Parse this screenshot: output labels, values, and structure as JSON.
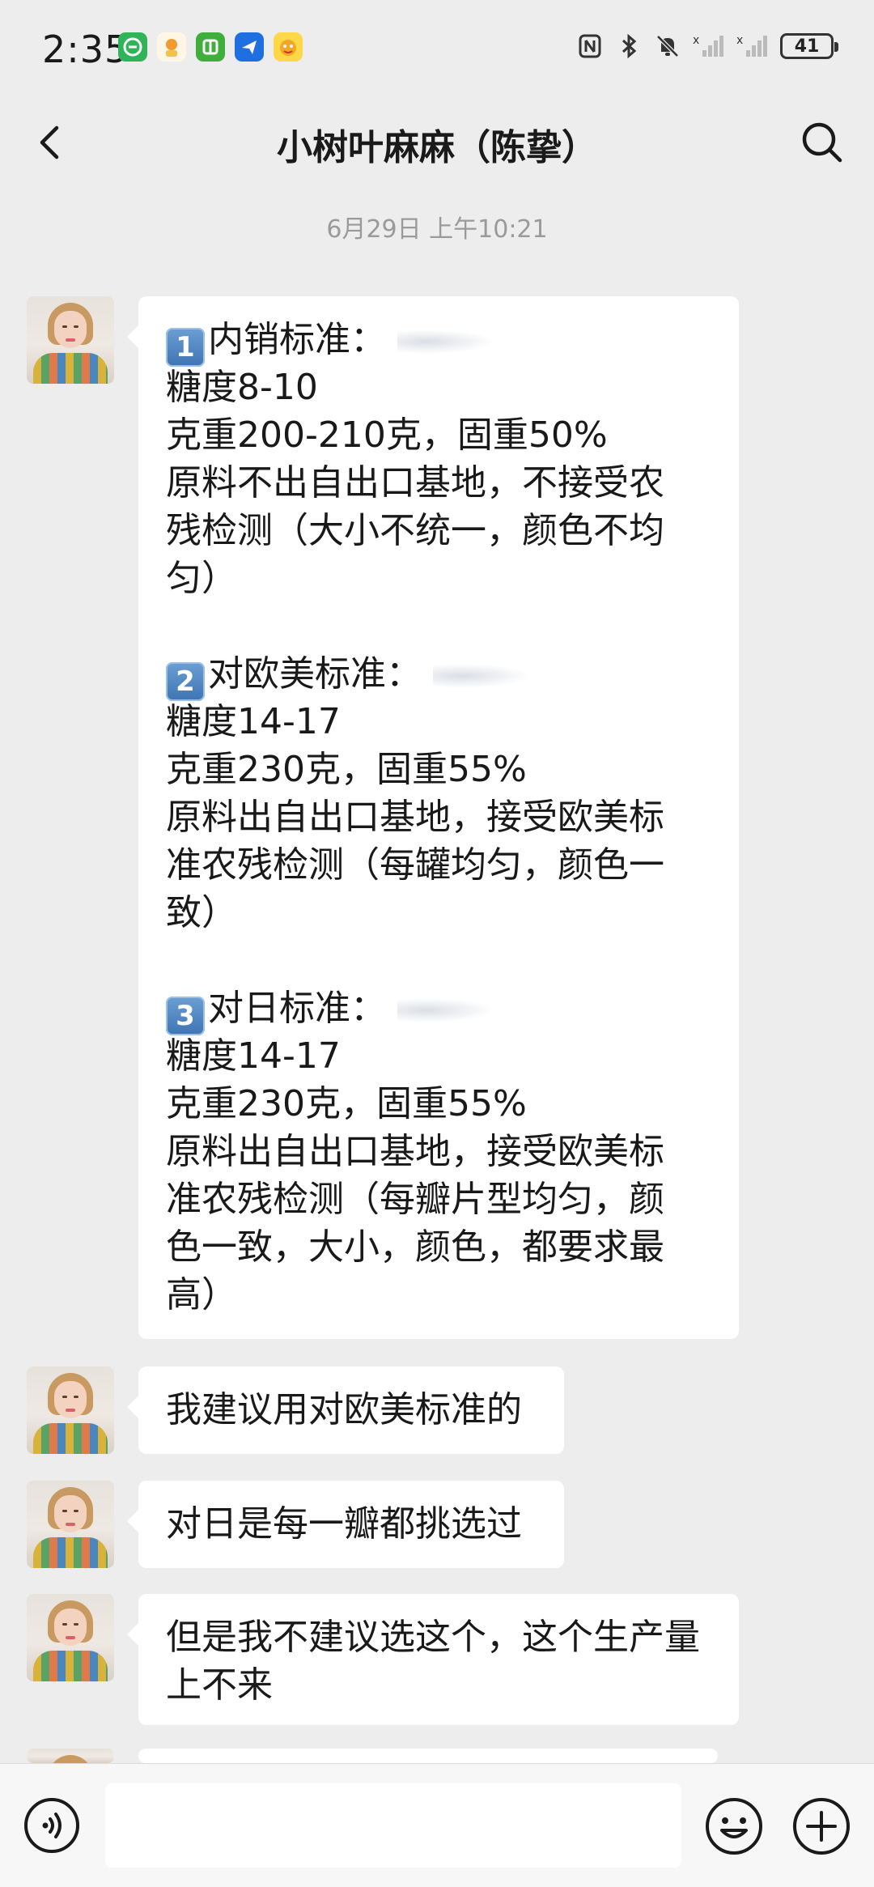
{
  "status_bar": {
    "time": "2:35",
    "battery": "41",
    "app_icons": [
      "green-leaf-app-icon",
      "orange-mascot-app-icon",
      "green-app-icon",
      "blue-plane-app-icon",
      "yellow-cartoon-app-icon"
    ],
    "system_icons": [
      "nfc-icon",
      "bluetooth-icon",
      "mute-bell-icon",
      "signal-x-icon",
      "signal-x-icon",
      "battery-icon"
    ]
  },
  "header": {
    "title": "小树叶麻麻（陈挚）"
  },
  "timestamp": "6月29日 上午10:21",
  "messages": [
    {
      "lines": [
        {
          "badge": "1",
          "text": "内销标准："
        },
        {
          "text": "糖度8-10"
        },
        {
          "text": "克重200-210克，固重50%"
        },
        {
          "text": "原料不出自出口基地，不接受农"
        },
        {
          "text": "残检测（大小不统一，颜色不均"
        },
        {
          "text": "匀）"
        },
        {
          "text": ""
        },
        {
          "badge": "2",
          "text": "对欧美标准："
        },
        {
          "text": "糖度14-17"
        },
        {
          "text": "克重230克，固重55%"
        },
        {
          "text": "原料出自出口基地，接受欧美标"
        },
        {
          "text": "准农残检测（每罐均匀，颜色一"
        },
        {
          "text": "致）"
        },
        {
          "text": ""
        },
        {
          "badge": "3",
          "text": "对日标准："
        },
        {
          "text": "糖度14-17"
        },
        {
          "text": "克重230克，固重55%"
        },
        {
          "text": "原料出自出口基地，接受欧美标"
        },
        {
          "text": "准农残检测（每瓣片型均匀，颜"
        },
        {
          "text": "色一致，大小，颜色，都要求最"
        },
        {
          "text": "高）"
        }
      ]
    },
    {
      "lines": [
        {
          "text": "我建议用对欧美标准的"
        }
      ]
    },
    {
      "lines": [
        {
          "text": "对日是每一瓣都挑选过"
        }
      ]
    },
    {
      "lines": [
        {
          "text": "但是我不建议选这个，这个生产量"
        },
        {
          "text": "上不来"
        }
      ]
    }
  ],
  "input_bar": {
    "placeholder": ""
  },
  "colors": {
    "background": "#ededed",
    "bubble": "#ffffff",
    "badge_blue": "#3e74b3"
  }
}
